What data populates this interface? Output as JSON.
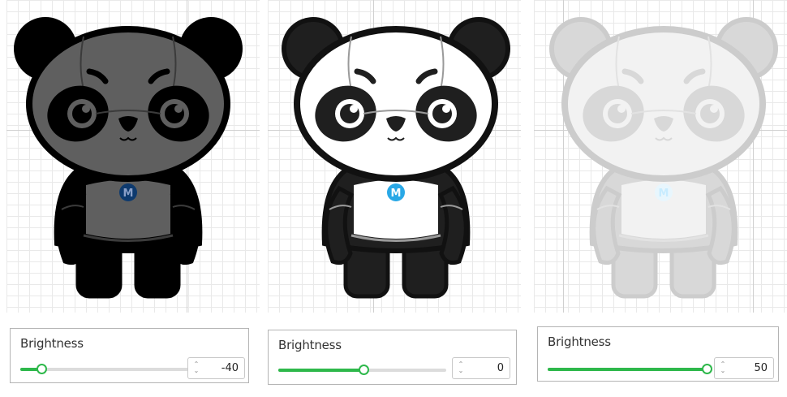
{
  "colors": {
    "accent": "#2eb84b",
    "track": "#dcdcdc",
    "badge": "#29a8e6",
    "dark_panda": "#000000",
    "normal_panda": "#1f1f1f",
    "light_panda": "#d8d8d8"
  },
  "icons": {
    "badge_icon": "m-badge-icon",
    "stepper_icon": "up-down-chevron-icon"
  },
  "controls": [
    {
      "label": "Brightness",
      "value": "-40",
      "slider_fraction": 0.1
    },
    {
      "label": "Brightness",
      "value": "0",
      "slider_fraction": 0.5
    },
    {
      "label": "Brightness",
      "value": "50",
      "slider_fraction": 1.0
    }
  ]
}
